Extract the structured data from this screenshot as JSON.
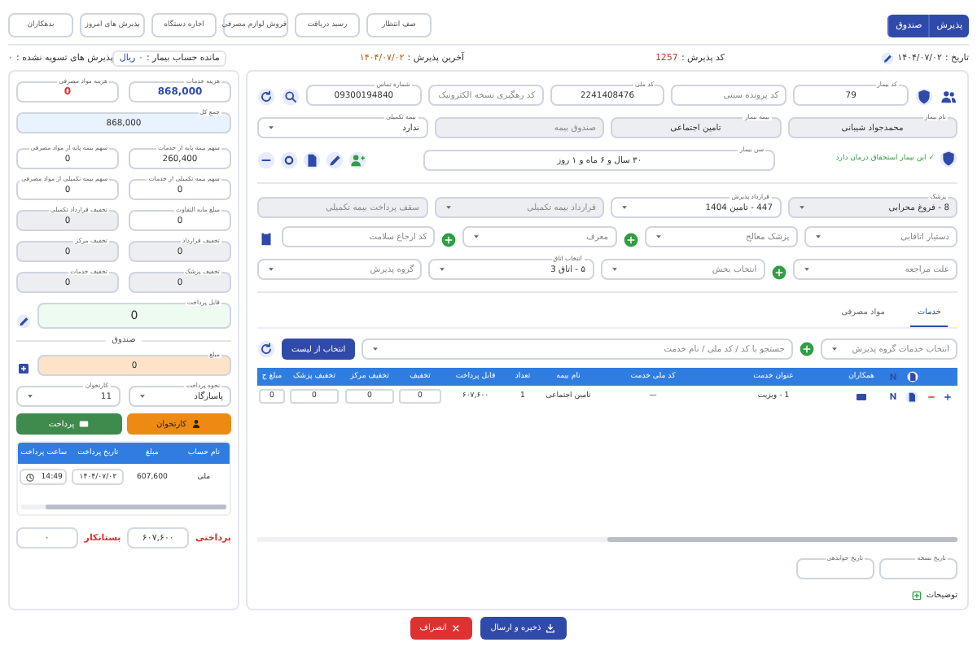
{
  "header": {
    "mode_buttons": [
      {
        "label": "پذیرش",
        "selected": true
      },
      {
        "label": "صندوق",
        "selected": true
      }
    ],
    "toolbar_buttons": [
      "صف انتظار",
      "رسید دریافت",
      "فروش لوازم مصرفی",
      "اجاره دستگاه",
      "پذیرش های امروز",
      "بدهکاران"
    ]
  },
  "info": {
    "date_label": "تاریخ :",
    "date": "۱۴۰۴/۰۷/۰۲",
    "admission_code_label": "کد پذیرش :",
    "admission_code": "1257",
    "last_admission_label": "آخرین پذیرش :",
    "last_admission": "۱۴۰۴/۰۷/۰۲",
    "balance_label": "مانده حساب بیمار :",
    "balance": "۰ ریال",
    "unsettled_label": "پذیرش های تسویه نشده :",
    "unsettled": "۰"
  },
  "patient": {
    "rows": [
      {
        "fields": [
          {
            "kind": "input",
            "label": "کد بیمار",
            "value": "79"
          },
          {
            "kind": "input",
            "placeholder": "کد پرونده سنتی"
          },
          {
            "kind": "input",
            "label": "کد ملی",
            "value": "2241408476"
          },
          {
            "kind": "input",
            "placeholder": "کد رهگیری نسخه الکترونیک"
          },
          {
            "kind": "input",
            "label": "شماره تماس",
            "value": "09300194840"
          }
        ]
      },
      {
        "fields": [
          {
            "kind": "input",
            "label": "نام بیمار",
            "value": "محمدجواد شیبانی",
            "disabled": true
          },
          {
            "kind": "input",
            "label": "بیمه بیمار",
            "value": "تامین اجتماعی",
            "disabled": true
          },
          {
            "kind": "input",
            "placeholder": "صندوق بیمه",
            "disabled": true
          },
          {
            "kind": "select",
            "label": "بیمه تکمیلی",
            "value": "ندارد",
            "disabled": false
          }
        ]
      },
      {
        "eligibility": "✓ این بیمار استحقاق درمان دارد",
        "fields": [
          {
            "kind": "input",
            "label": "سن بیمار",
            "value": "۳۰ سال و ۶ ماه و ۱ روز"
          }
        ]
      }
    ]
  },
  "admission": {
    "rows": [
      {
        "fields": [
          {
            "kind": "select",
            "label": "پزشک",
            "value": "8 - فروغ محرابی",
            "disabled": true
          },
          {
            "kind": "select",
            "label": "قرارداد پذیرش",
            "value": "447 - تامین 1404",
            "disabled": false
          },
          {
            "kind": "select",
            "placeholder": "قرارداد بیمه تکمیلی",
            "disabled": true
          },
          {
            "kind": "input",
            "placeholder": "سقف پرداخت بیمه تکمیلی",
            "disabled": true
          }
        ]
      },
      {
        "fields": [
          {
            "kind": "select",
            "placeholder": "دستیار اتاقایی"
          },
          {
            "kind": "select",
            "placeholder": "پزشک معالج",
            "addable": true
          },
          {
            "kind": "select",
            "placeholder": "معرف",
            "addable": true
          },
          {
            "kind": "input",
            "placeholder": "کد ارجاع سلامت"
          }
        ]
      },
      {
        "fields": [
          {
            "kind": "select",
            "placeholder": "علت مراجعه",
            "addable": true
          },
          {
            "kind": "select",
            "placeholder": "انتخاب بخش"
          },
          {
            "kind": "select",
            "label": "انتخاب اتاق",
            "value": "۵ - اتاق 3"
          },
          {
            "kind": "select",
            "placeholder": "گروه پذیرش"
          }
        ]
      }
    ]
  },
  "services": {
    "tabs": [
      {
        "label": "خدمات",
        "selected": true
      },
      {
        "label": "مواد مصرفی",
        "selected": false
      }
    ],
    "group_select": {
      "placeholder": "انتخاب خدمات گروه پذیرش"
    },
    "search": {
      "placeholder": "جستجو با کد / کد ملی / نام خدمت"
    },
    "list_button": "انتخاب از لیست",
    "table": {
      "columns": [
        "همکاران",
        "عنوان خدمت",
        "کد ملی خدمت",
        "نام بیمه",
        "تعداد",
        "قابل پرداخت",
        "تخفیف",
        "تخفیف مرکز",
        "تخفیف پزشک",
        "مبلغ ج"
      ],
      "rows": [
        {
          "cells": [
            {
              "kind": "icon"
            },
            {
              "kind": "text",
              "text": "1 - ویزیت"
            },
            {
              "kind": "text",
              "text": "—"
            },
            {
              "kind": "text",
              "text": "تامین اجتماعی"
            },
            {
              "kind": "text",
              "text": "1"
            },
            {
              "kind": "text",
              "text": "۶۰۷,۶۰۰"
            },
            {
              "kind": "input",
              "text": "0"
            },
            {
              "kind": "input",
              "text": "0"
            },
            {
              "kind": "input",
              "text": "0"
            },
            {
              "kind": "input",
              "text": "0"
            }
          ]
        }
      ]
    },
    "dates": [
      {
        "label": "تاریخ نسخه"
      },
      {
        "label": "تاریخ جوابدهی"
      }
    ],
    "notes_label": "توضیحات"
  },
  "summary": {
    "fields": [
      {
        "kind": "field",
        "label": "هزینه خدمات",
        "value": "868,000",
        "color": "#2f4aa8"
      },
      {
        "kind": "field",
        "label": "هزینه مواد مصرفی",
        "value": "0",
        "color": "#e03131"
      },
      {
        "kind": "total",
        "label": "جمع کل",
        "value": "868,000"
      },
      {
        "kind": "field",
        "label": "سهم بیمه پایه از خدمات",
        "value": "260,400"
      },
      {
        "kind": "field",
        "label": "سهم بیمه پایه از مواد مصرفی",
        "value": "0"
      },
      {
        "kind": "field",
        "label": "سهم بیمه تکمیلی از خدمات",
        "value": "0"
      },
      {
        "kind": "field",
        "label": "سهم بیمه تکمیلی از مواد مصرفی",
        "value": "0"
      },
      {
        "kind": "field",
        "label": "مبلغ مابه التفاوت",
        "value": "0"
      },
      {
        "kind": "field",
        "label": "تخفیف قرارداد تکمیلی",
        "value": "0",
        "disabled": true
      },
      {
        "kind": "field",
        "label": "تخفیف قرارداد",
        "value": "0",
        "disabled": true
      },
      {
        "kind": "field",
        "label": "تخفیف مرکز",
        "value": "0",
        "disabled": true
      },
      {
        "kind": "field",
        "label": "تخفیف پزشک",
        "value": "0",
        "disabled": true
      },
      {
        "kind": "field",
        "label": "تخفیف خدمات",
        "value": "0",
        "disabled": true
      },
      {
        "kind": "payable",
        "label": "قابل پرداخت",
        "value": "0"
      }
    ]
  },
  "cashbox": {
    "title": "صندوق",
    "amount": {
      "label": "مبلغ",
      "value": "0"
    },
    "selects": [
      {
        "label": "نحوه پرداخت",
        "value": "پاسارگاد"
      },
      {
        "label": "کارتخوان",
        "value": "11"
      }
    ],
    "buttons": [
      {
        "label": "کارتخوان",
        "kind": "pos"
      },
      {
        "label": "پرداخت",
        "kind": "pay"
      }
    ],
    "table": {
      "columns": [
        "نام حساب",
        "مبلغ",
        "تاریخ پرداخت",
        "ساعت پرداخت"
      ],
      "rows": [
        {
          "account": "ملی",
          "amount": "607,600",
          "date": "۱۴۰۴/۰۷/۰۲",
          "time": "14:49"
        }
      ]
    },
    "totals": [
      {
        "label": "پرداختی",
        "value": "۶۰۷,۶۰۰"
      },
      {
        "label": "بستانکار",
        "value": "۰"
      }
    ]
  },
  "actions": [
    {
      "label": "ذخیره و ارسال",
      "kind": "save"
    },
    {
      "label": "انصراف",
      "kind": "cancel"
    }
  ]
}
